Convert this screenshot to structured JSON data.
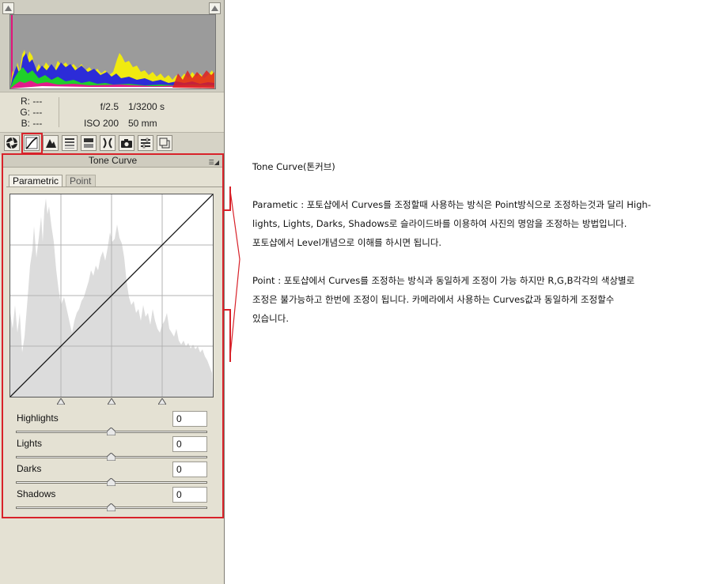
{
  "histogram": {
    "clip_shadows_icon": "triangle-up-icon",
    "clip_highlights_icon": "triangle-up-icon"
  },
  "info": {
    "r_label": "R:",
    "r_value": "---",
    "g_label": "G:",
    "g_value": "---",
    "b_label": "B:",
    "b_value": "---",
    "aperture": "f/2.5",
    "shutter": "1/3200 s",
    "iso": "ISO 200",
    "focal": "50 mm"
  },
  "toolbar": {
    "icons": [
      "aperture-icon",
      "tone-curve-icon",
      "detail-icon",
      "hsl-icon",
      "split-toning-icon",
      "lens-icon",
      "camera-calibration-icon",
      "presets-icon",
      "snapshots-icon"
    ]
  },
  "panel": {
    "title": "Tone Curve",
    "menu_icon": "panel-menu-icon",
    "tabs": [
      "Parametric",
      "Point"
    ]
  },
  "sliders": [
    {
      "label": "Highlights",
      "value": "0"
    },
    {
      "label": "Lights",
      "value": "0"
    },
    {
      "label": "Darks",
      "value": "0"
    },
    {
      "label": "Shadows",
      "value": "0"
    }
  ],
  "notes": {
    "title": "Tone Curve(톤커브)",
    "parametric_line1": "Parametic : 포토샵에서 Curves를 조정할때 사용하는 방식은 Point방식으로 조정하는것과 달리 High-",
    "parametric_line2": "lights, Lights, Darks, Shadows로 슬라이드바를 이용하여 사진의 명암을 조정하는 방법입니다.",
    "parametric_line3": "포토샵에서 Level개념으로 이해를 하시면 됩니다.",
    "point_line1": "Point : 포토샵에서 Curves를 조정하는 방식과 동일하게 조정이 가능 하지만 R,G,B각각의 색상별로",
    "point_line2": "조정은 불가능하고 한번에 조정이 됩니다. 카메라에서 사용하는 Curves값과 동일하게 조정할수",
    "point_line3": "있습니다."
  },
  "colors": {
    "highlight_box": "#d8222a",
    "panel_bg": "#e4e1d3",
    "histogram_bg": "#9b9b9b",
    "curve_fill": "#dcdcdc"
  }
}
